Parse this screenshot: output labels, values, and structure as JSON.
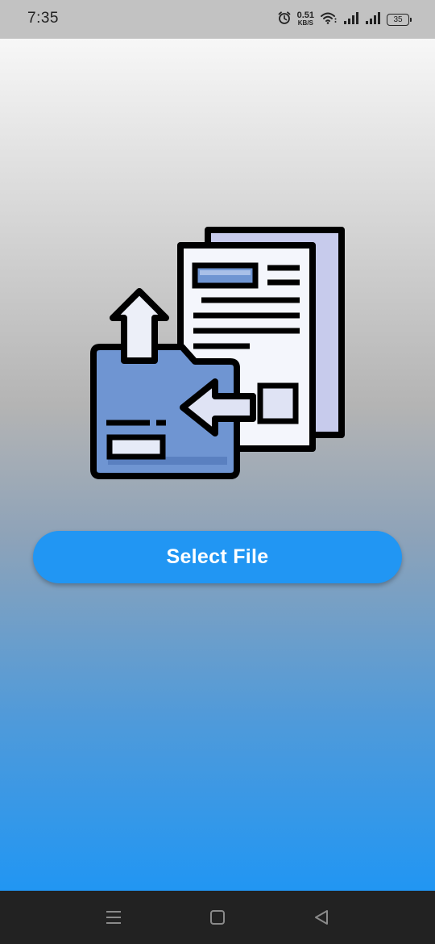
{
  "status_bar": {
    "time": "7:35",
    "net_speed_value": "0.51",
    "net_speed_unit": "KB/S",
    "battery": "35",
    "icons": [
      "alarm-icon",
      "wifi-icon",
      "signal-icon",
      "signal-icon",
      "battery-icon"
    ]
  },
  "main": {
    "illustration_icon": "file-upload-transfer-icon",
    "select_button_label": "Select File"
  },
  "nav_bar": {
    "icons": [
      "menu-icon",
      "home-square-icon",
      "back-triangle-icon"
    ]
  },
  "colors": {
    "accent": "#2196f3",
    "status_bar": "#c2c2c2",
    "nav_bar": "#222222",
    "gradient_top": "#f7f7f7",
    "gradient_bottom": "#2196f3"
  }
}
